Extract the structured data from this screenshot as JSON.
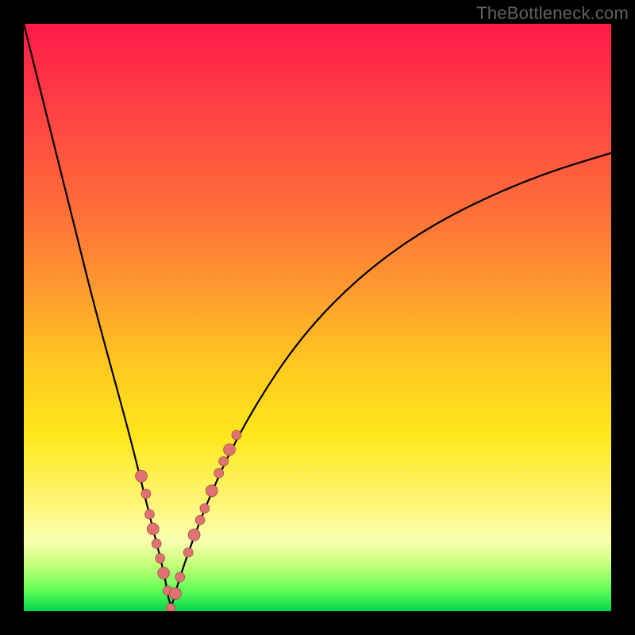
{
  "watermark": "TheBottleneck.com",
  "colors": {
    "frame": "#000000",
    "curve": "#000000",
    "dot_fill": "#e07272",
    "dot_stroke": "#8a3d3d"
  },
  "chart_data": {
    "type": "line",
    "title": "",
    "xlabel": "",
    "ylabel": "",
    "xlim": [
      0,
      100
    ],
    "ylim": [
      0,
      100
    ],
    "grid": false,
    "legend": false,
    "series": [
      {
        "name": "bottleneck-curve",
        "note": "V-shaped curve; minimum ≈ x 25, y 0. Values estimated from shape (no tick labels present).",
        "x": [
          0,
          3,
          6,
          9,
          12,
          15,
          18,
          20,
          22,
          24,
          25,
          26,
          28,
          31,
          35,
          40,
          46,
          53,
          61,
          70,
          80,
          90,
          100
        ],
        "y": [
          100,
          88,
          76,
          64,
          52,
          41,
          30,
          22,
          14,
          6,
          0,
          4,
          10,
          18,
          27,
          36,
          45,
          53,
          60,
          66,
          71,
          75,
          78
        ]
      }
    ],
    "dots": {
      "name": "highlighted-points",
      "note": "Pink/salmon markers clustered near the bottom of both legs of the V. Coordinates estimated.",
      "x": [
        20.0,
        20.8,
        21.4,
        22.0,
        22.6,
        23.2,
        23.8,
        24.5,
        25.0,
        25.8,
        26.6,
        28.0,
        29.0,
        30.0,
        30.8,
        32.0,
        33.2,
        34.0,
        35.0,
        36.2
      ],
      "y": [
        23.0,
        20.0,
        16.5,
        14.0,
        11.5,
        9.0,
        6.5,
        3.5,
        0.5,
        3.0,
        5.8,
        10.0,
        13.0,
        15.5,
        17.5,
        20.5,
        23.5,
        25.5,
        27.5,
        30.0
      ]
    }
  }
}
